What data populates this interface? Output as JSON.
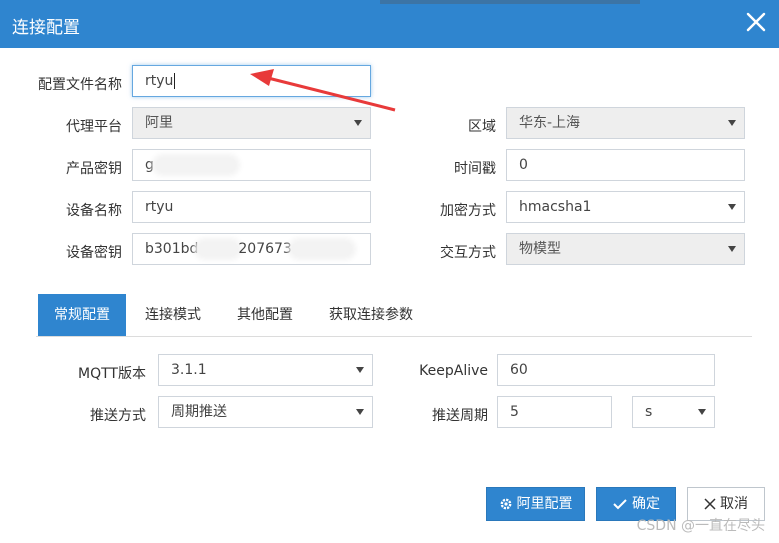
{
  "dialog": {
    "title": "连接配置"
  },
  "form": {
    "config_name_label": "配置文件名称",
    "config_name_value": "rtyu",
    "proxy_platform_label": "代理平台",
    "proxy_platform_value": "阿里",
    "region_label": "区域",
    "region_value": "华东-上海",
    "product_key_label": "产品密钥",
    "product_key_value": "g",
    "timestamp_label": "时间戳",
    "timestamp_value": "0",
    "device_name_label": "设备名称",
    "device_name_value": "rtyu",
    "encrypt_label": "加密方式",
    "encrypt_value": "hmacsha1",
    "device_secret_label": "设备密钥",
    "device_secret_value_a": "b301bd",
    "device_secret_value_b": "207673",
    "interact_label": "交互方式",
    "interact_value": "物模型"
  },
  "tabs": [
    {
      "label": "常规配置",
      "active": true
    },
    {
      "label": "连接模式",
      "active": false
    },
    {
      "label": "其他配置",
      "active": false
    },
    {
      "label": "获取连接参数",
      "active": false
    }
  ],
  "general": {
    "mqtt_version_label": "MQTT版本",
    "mqtt_version_value": "3.1.1",
    "keepalive_label": "KeepAlive",
    "keepalive_value": "60",
    "push_mode_label": "推送方式",
    "push_mode_value": "周期推送",
    "push_period_label": "推送周期",
    "push_period_value": "5",
    "push_period_unit": "s"
  },
  "buttons": {
    "ali_config": "阿里配置",
    "confirm": "确定",
    "cancel": "取消"
  },
  "watermark": "CSDN @一直在尽头",
  "colors": {
    "primary": "#2f85cf",
    "annotation_arrow": "#e83a3a"
  }
}
